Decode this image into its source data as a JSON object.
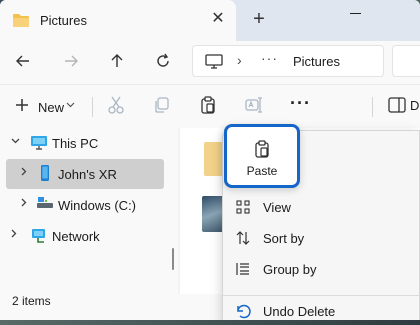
{
  "window": {
    "tab_title": "Pictures",
    "new_tab_symbol": "+",
    "close_symbol": "✕"
  },
  "address_bar": {
    "separator": "›",
    "overflow": "···",
    "location": "Pictures"
  },
  "command_bar": {
    "new_label": "New",
    "details_label": "D",
    "more_symbol": "···"
  },
  "nav_pane": {
    "items": [
      {
        "label": "This PC",
        "expanded": true,
        "icon": "monitor-icon"
      },
      {
        "label": "John's XR",
        "expanded": false,
        "selected": true,
        "icon": "phone-icon"
      },
      {
        "label": "Windows (C:)",
        "expanded": false,
        "icon": "drive-icon"
      },
      {
        "label": "Network",
        "expanded": false,
        "icon": "network-icon"
      }
    ]
  },
  "status_bar": {
    "item_count": "2 items"
  },
  "context_menu": {
    "paste_label": "Paste",
    "items": [
      {
        "label": "View",
        "icon": "view-grid-icon"
      },
      {
        "label": "Sort by",
        "icon": "sort-icon"
      },
      {
        "label": "Group by",
        "icon": "group-icon"
      },
      {
        "label": "Undo Delete",
        "icon": "undo-icon"
      }
    ]
  },
  "colors": {
    "accent": "#1466c8",
    "folder": "#f2c14e"
  }
}
